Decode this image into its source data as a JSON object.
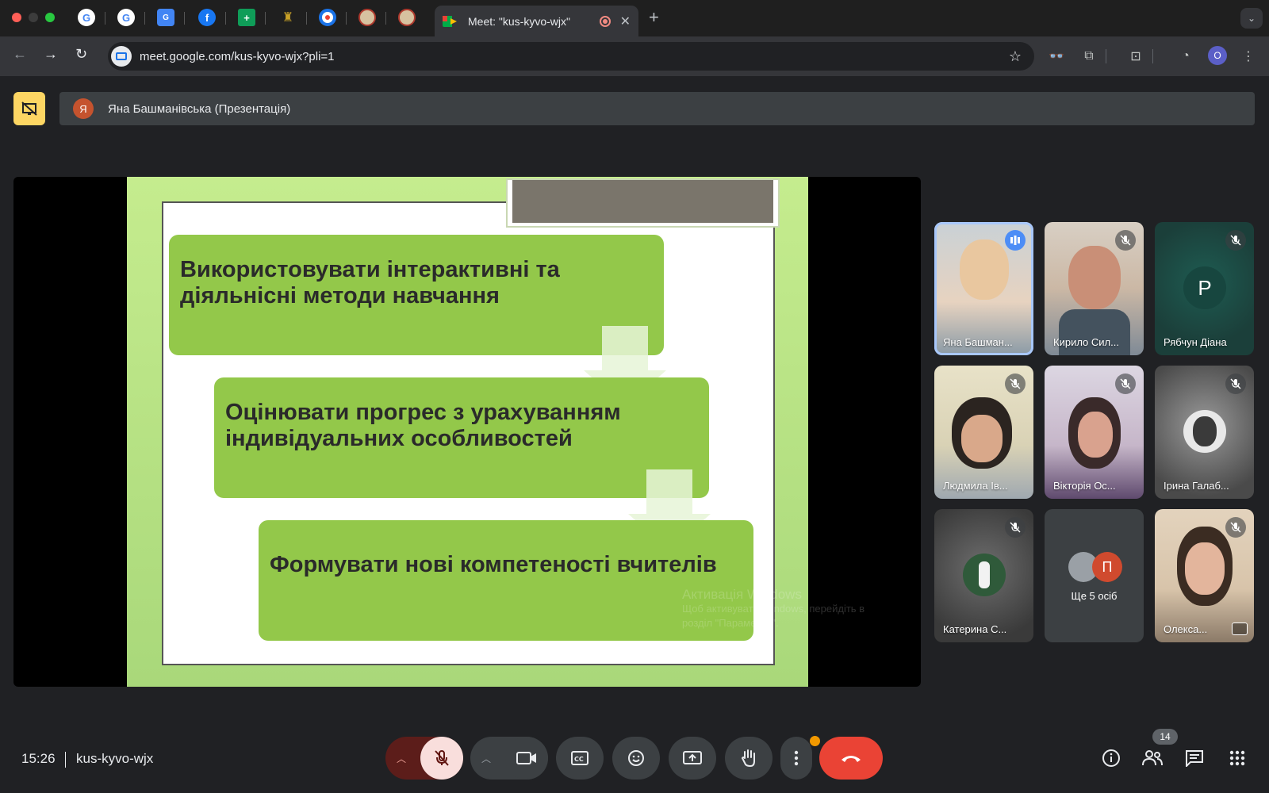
{
  "browser": {
    "active_tab_title": "Meet: \"kus-kyvo-wjx\"",
    "new_tab_symbol": "+",
    "url": "meet.google.com/kus-kyvo-wjx?pli=1",
    "profile_initial": "O",
    "pinned_tabs": [
      "google-icon",
      "google-icon",
      "google-translate-icon",
      "facebook-icon",
      "google-sheets-icon",
      "crest-icon",
      "record-icon",
      "seal-icon",
      "seal-icon"
    ]
  },
  "meet": {
    "presenter": {
      "initial": "Я",
      "label": "Яна Башманівська (Презентація)"
    },
    "slide": {
      "steps": [
        "Використовувати інтерактивні та діяльнісні методи навчання",
        "Оцінювати прогрес з урахуванням індивідуальних особливостей",
        "Формувати нові компетеності вчителів"
      ],
      "watermark_line1": "Активація Windows",
      "watermark_line2": "Щоб активувати Windows, перейдіть в",
      "watermark_line3": "розділ \"Параметри\"."
    },
    "participants": [
      {
        "name": "Яна Башман...",
        "status": "speaking"
      },
      {
        "name": "Кирило Сил...",
        "status": "muted"
      },
      {
        "name": "Рябчун Діана",
        "status": "muted",
        "initial": "Р"
      },
      {
        "name": "Людмила Ів...",
        "status": "muted"
      },
      {
        "name": "Вікторія Ос...",
        "status": "muted"
      },
      {
        "name": "Ірина Галаб...",
        "status": "muted"
      },
      {
        "name": "Катерина С...",
        "status": "muted"
      },
      {
        "name": "Олекса...",
        "status": "muted"
      }
    ],
    "more_tile": {
      "initial": "П",
      "label": "Ще 5 осіб"
    },
    "footer": {
      "time": "15:26",
      "meeting_code": "kus-kyvo-wjx",
      "participant_count": "14"
    }
  },
  "colors": {
    "accent": "#a8c7fa",
    "leave": "#ea4335",
    "mic_off_bg": "#f9dedc",
    "warning": "#fdd663",
    "slide_green": "#93c84a"
  }
}
